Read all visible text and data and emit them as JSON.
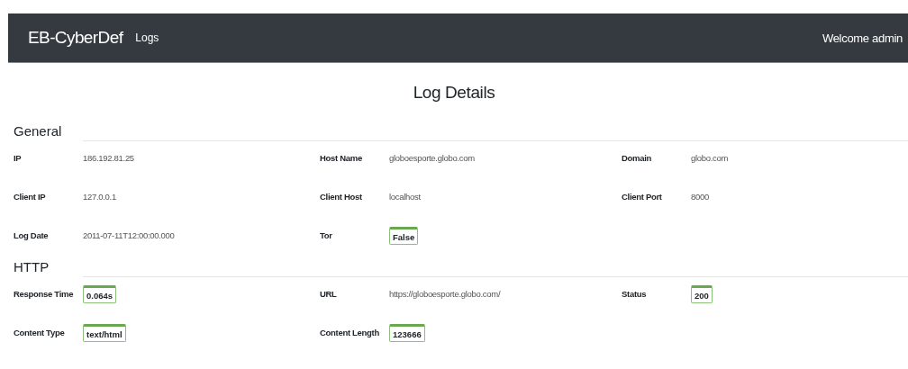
{
  "navbar": {
    "brand": "EB-CyberDef",
    "links": [
      {
        "label": "Logs"
      }
    ],
    "welcome": "Welcome admin"
  },
  "title": "Log Details",
  "sections": [
    {
      "heading": "General",
      "fields": [
        {
          "label": "IP",
          "value": "186.192.81.25",
          "kind": "text"
        },
        {
          "label": "Host Name",
          "value": "globoesporte.globo.com",
          "kind": "text"
        },
        {
          "label": "Domain",
          "value": "globo.com",
          "kind": "text"
        },
        {
          "label": "Client IP",
          "value": "127.0.0.1",
          "kind": "text"
        },
        {
          "label": "Client Host",
          "value": "localhost",
          "kind": "text"
        },
        {
          "label": "Client Port",
          "value": "8000",
          "kind": "text"
        },
        {
          "label": "Log Date",
          "value": "2011-07-11T12:00:00.000",
          "kind": "text"
        },
        {
          "label": "Tor",
          "value": "False",
          "kind": "badge"
        }
      ]
    },
    {
      "heading": "HTTP",
      "fields": [
        {
          "label": "Response Time",
          "value": "0.064s",
          "kind": "badge"
        },
        {
          "label": "URL",
          "value": "https://globoesporte.globo.com/",
          "kind": "text"
        },
        {
          "label": "Status",
          "value": "200",
          "kind": "badge"
        },
        {
          "label": "Content Type",
          "value": "text/html",
          "kind": "badge"
        },
        {
          "label": "Content Length",
          "value": "123666",
          "kind": "badge"
        }
      ]
    }
  ]
}
